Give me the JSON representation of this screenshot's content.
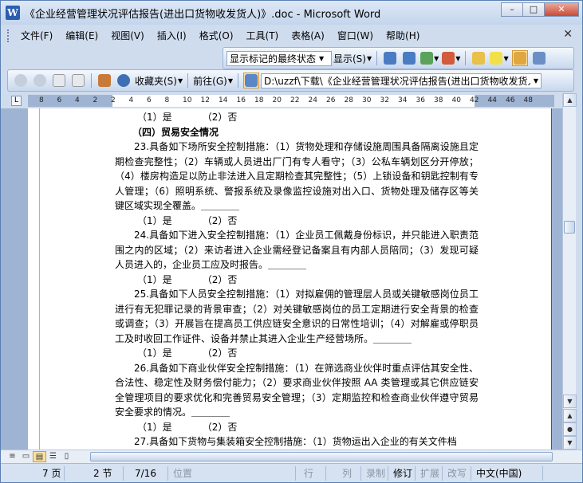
{
  "window": {
    "title": "《企业经营管理状况评估报告(进出口货物收发货人)》.doc - Microsoft Word",
    "minimize": "–",
    "maximize": "□",
    "close": "✕"
  },
  "menubar": {
    "items": [
      "文件(F)",
      "编辑(E)",
      "视图(V)",
      "插入(I)",
      "格式(O)",
      "工具(T)",
      "表格(A)",
      "窗口(W)",
      "帮助(H)"
    ],
    "doc_close": "✕"
  },
  "review_toolbar": {
    "display_mode": "显示标记的最终状态",
    "show_label": "显示(S)"
  },
  "web_toolbar": {
    "favorites_label": "收藏夹(S)",
    "goto_label": "前往(G)",
    "address": "D:\\uzzf\\下载\\《企业经营管理状况评估报告(进出口货物收发货人"
  },
  "ruler": {
    "numbers": [
      "8",
      "6",
      "4",
      "2",
      "2",
      "4",
      "6",
      "8",
      "10",
      "12",
      "14",
      "16",
      "18",
      "20",
      "22",
      "24",
      "26",
      "28",
      "30",
      "32",
      "34",
      "36",
      "38",
      "40",
      "42",
      "44",
      "46",
      "48"
    ]
  },
  "document": {
    "lines": [
      {
        "type": "opt",
        "text": "（1）是          （2）否"
      },
      {
        "type": "head",
        "text": "（四）贸易安全情况"
      },
      {
        "type": "para",
        "text": "23.具备如下场所安全控制措施：（1）货物处理和存储设施周围具备隔离设施且定期检查完整性；（2）车辆或人员进出厂门有专人看守；（3）公私车辆划区分开停放；（4）楼房构造足以防止非法进入且定期检查其完整性；（5）上锁设备和钥匙控制有专人管理；（6）照明系统、警报系统及录像监控设施对出入口、货物处理及储存区等关键区域实现全覆盖。＿＿＿＿"
      },
      {
        "type": "opt",
        "text": "（1）是          （2）否"
      },
      {
        "type": "para",
        "text": "24.具备如下进入安全控制措施：（1）企业员工佩戴身份标识，并只能进入职责范围之内的区域；（2）来访者进入企业需经登记备案且有内部人员陪同；（3）发现可疑人员进入的，企业员工应及时报告。＿＿＿＿"
      },
      {
        "type": "opt",
        "text": "（1）是          （2）否"
      },
      {
        "type": "para",
        "text": "25.具备如下人员安全控制措施：（1）对拟雇佣的管理层人员或关键敏感岗位员工进行有无犯罪记录的背景审查；（2）对关键敏感岗位的员工定期进行安全背景的检查或调查；（3）开展旨在提高员工供应链安全意识的日常性培训；（4）对解雇或停职员工及时收回工作证件、设备并禁止其进入企业生产经营场所。＿＿＿＿"
      },
      {
        "type": "opt",
        "text": "（1）是          （2）否"
      },
      {
        "type": "para",
        "text": "26.具备如下商业伙伴安全控制措施：（1）在筛选商业伙伴时重点评估其安全性、合法性、稳定性及财务偿付能力；（2）要求商业伙伴按照 AA 类管理或其它供应链安全管理项目的要求优化和完善贸易安全管理；（3）定期监控和检查商业伙伴遵守贸易安全要求的情况。＿＿＿＿"
      },
      {
        "type": "opt",
        "text": "（1）是          （2）否"
      },
      {
        "type": "para",
        "text": "27.具备如下货物与集装箱安全控制措施：（1）货物运出入企业的有关文件档"
      }
    ]
  },
  "statusbar": {
    "page": "7 页",
    "section": "2 节",
    "page_of": "7/16",
    "position": "位置",
    "line": "行",
    "column": "列",
    "rec": "录制",
    "trk": "修订",
    "ext": "扩展",
    "ovr": "改写",
    "language": "中文(中国)"
  }
}
